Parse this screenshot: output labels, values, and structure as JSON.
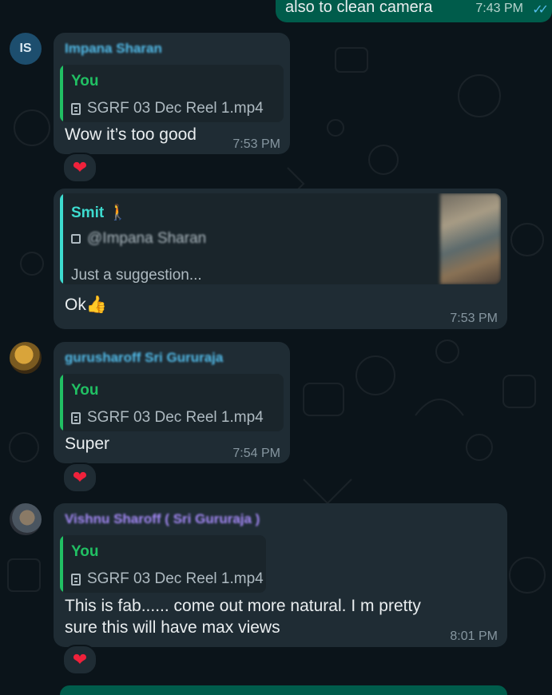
{
  "outgoing": {
    "text": "also to clean camera",
    "time": "7:43 PM"
  },
  "messages": [
    {
      "avatar_text": "IS",
      "sender": "Impana Sharan",
      "sender_color": "#53bdeb",
      "quote_name": "You",
      "quote_file": "SGRF 03 Dec Reel 1.mp4",
      "text": "Wow it’s too good",
      "time": "7:53 PM",
      "reaction": "❤"
    },
    {
      "quote_name": "Smit 🚶",
      "quote_sub": "@Impana Sharan",
      "quote_text": "Just a suggestion...",
      "text": "Ok👍",
      "time": "7:53 PM"
    },
    {
      "sender": "gurusharoff Sri Gururaja",
      "sender_color": "#53bdeb",
      "quote_name": "You",
      "quote_file": "SGRF 03 Dec Reel 1.mp4",
      "text": "Super",
      "time": "7:54 PM",
      "reaction": "❤"
    },
    {
      "sender": "Vishnu Sharoff ( Sri Gururaja )",
      "sender_color": "#a78bfa",
      "quote_name": "You",
      "quote_file": "SGRF 03 Dec Reel 1.mp4",
      "text_line1": "This is fab...... come out more natural. I m pretty",
      "text_line2": "sure this will have max views",
      "time": "8:01 PM",
      "reaction": "❤"
    }
  ],
  "colors": {
    "you_quote": "#21c063",
    "smit_quote": "#3ddbcf",
    "accent_green": "#005c4b"
  }
}
